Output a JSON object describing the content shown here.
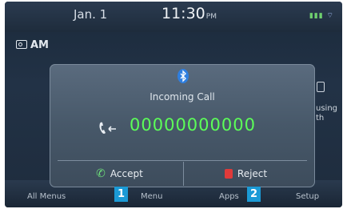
{
  "status": {
    "date": "Jan. 1",
    "time": "11:30",
    "ampm": "PM"
  },
  "radio": {
    "label": "AM"
  },
  "background_text": {
    "line1": "using",
    "line2": "th"
  },
  "bottom_menu": [
    "All Menus",
    "Menu",
    "Apps",
    "Setup"
  ],
  "popup": {
    "icon": "bluetooth-icon",
    "title": "Incoming Call",
    "number": "00000000000",
    "accept_label": "Accept",
    "reject_label": "Reject"
  },
  "callouts": [
    "1",
    "2"
  ],
  "colors": {
    "number": "#5cff58",
    "callout": "#1b9ad6",
    "reject": "#e03a3a",
    "accept": "#6ee07a"
  }
}
